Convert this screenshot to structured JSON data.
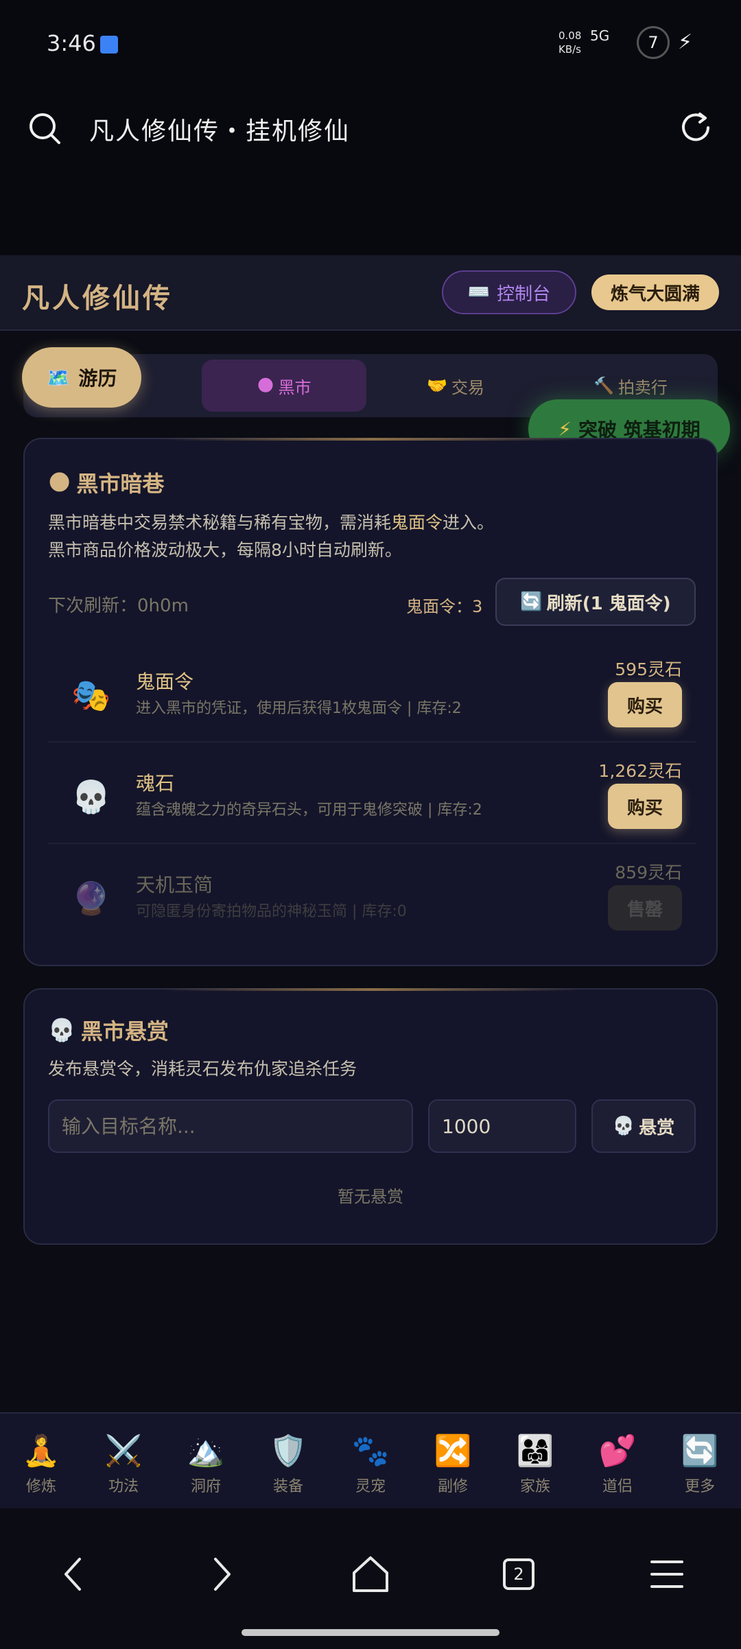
{
  "status": {
    "time": "3:46",
    "net_speed": "0.08\nKB/s",
    "signal": "5G",
    "battery": "7"
  },
  "browser": {
    "title": "凡人修仙传・挂机修仙"
  },
  "header": {
    "title": "凡人修仙传",
    "console_label": "控制台",
    "console_icon": "⌨️",
    "realm_badge": "炼气大圆满"
  },
  "tabs": [
    {
      "label": "黑市",
      "icon": "🌑",
      "active": true
    },
    {
      "label": "交易",
      "icon": "🤝"
    },
    {
      "label": "拍卖行",
      "icon": "🔨"
    }
  ],
  "float": {
    "travel_label": "游历",
    "travel_icon": "🗺️",
    "breakthrough_label": "突破 筑基初期",
    "breakthrough_icon": "⚡"
  },
  "blackmarket": {
    "title": "黑市暗巷",
    "title_icon": "🌑",
    "desc_line1_pre": "黑市暗巷中交易禁术秘籍与稀有宝物，需消耗",
    "desc_line1_hl": "鬼面令",
    "desc_line1_post": "进入。",
    "desc_line2": "黑市商品价格波动极大，每隔8小时自动刷新。",
    "next_refresh": "下次刷新：0h0m",
    "token_count": "鬼面令：3",
    "refresh_btn_icon": "🔄",
    "refresh_btn": "刷新(1 鬼面令)",
    "items": [
      {
        "icon": "🎭",
        "name": "鬼面令",
        "desc": "进入黑市的凭证，使用后获得1枚鬼面令 | 库存:2",
        "price": "595灵石",
        "action": "购买",
        "available": true
      },
      {
        "icon": "💀",
        "name": "魂石",
        "desc": "蕴含魂魄之力的奇异石头，可用于鬼修突破 | 库存:2",
        "price": "1,262灵石",
        "action": "购买",
        "available": true
      },
      {
        "icon": "🔮",
        "name": "天机玉简",
        "desc": "可隐匿身份寄拍物品的神秘玉简 | 库存:0",
        "price": "859灵石",
        "action": "售罄",
        "available": false
      }
    ]
  },
  "bounty": {
    "title": "黑市悬赏",
    "title_icon": "💀",
    "desc": "发布悬赏令，消耗灵石发布仇家追杀任务",
    "target_placeholder": "输入目标名称...",
    "amount_value": "1000",
    "button_icon": "💀",
    "button_label": "悬赏",
    "empty_note": "暂无悬赏"
  },
  "bottom_nav": [
    {
      "icon": "🧘",
      "label": "修炼"
    },
    {
      "icon": "⚔️",
      "label": "功法"
    },
    {
      "icon": "🏔️",
      "label": "洞府"
    },
    {
      "icon": "🛡️",
      "label": "装备"
    },
    {
      "icon": "🐾",
      "label": "灵宠"
    },
    {
      "icon": "🔀",
      "label": "副修"
    },
    {
      "icon": "👨‍👩‍👧",
      "label": "家族"
    },
    {
      "icon": "💕",
      "label": "道侣"
    },
    {
      "icon": "🔄",
      "label": "更多"
    }
  ],
  "system_nav": {
    "tab_count": "2"
  },
  "colors": {
    "accent_gold": "#d4b483",
    "accent_purple": "#b287f0",
    "breakthrough_green": "#2e7a3e",
    "bg": "#0b0c14"
  }
}
